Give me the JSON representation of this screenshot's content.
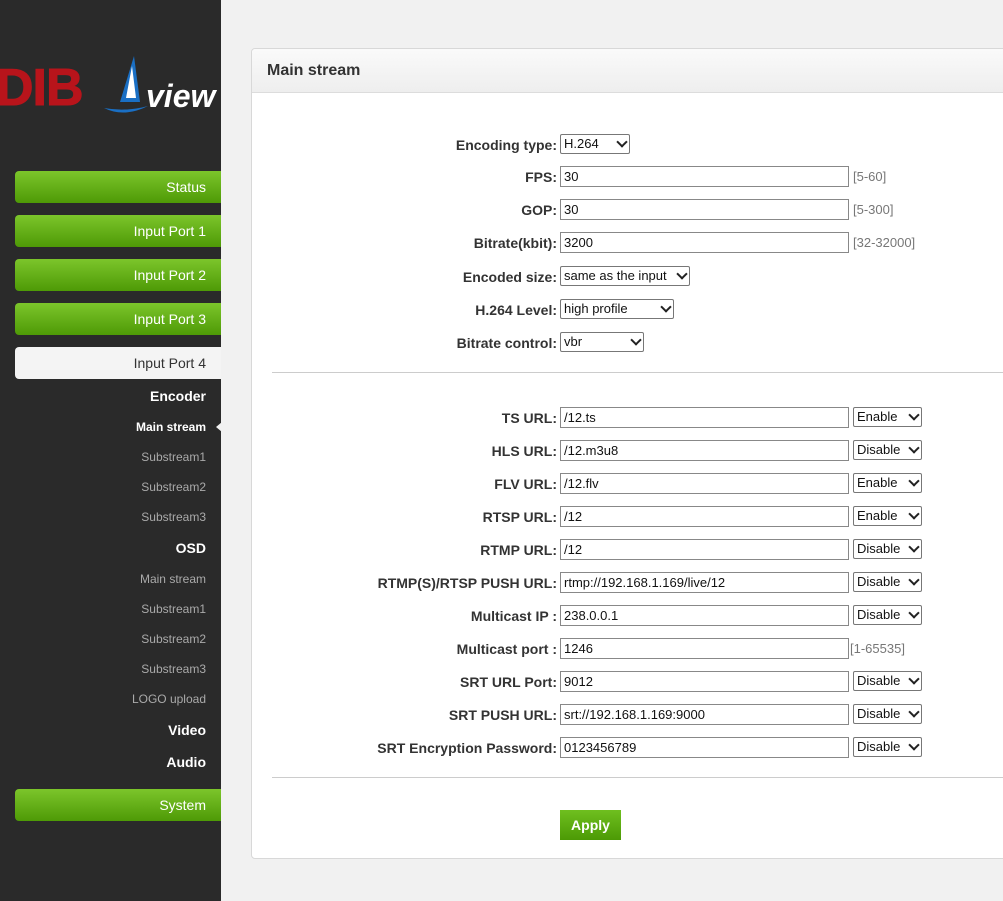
{
  "logo": {
    "left_text": "DIB",
    "right_text": "view"
  },
  "sidebar": {
    "buttons": {
      "status": "Status",
      "input1": "Input Port 1",
      "input2": "Input Port 2",
      "input3": "Input Port 3",
      "input4": "Input Port 4",
      "system": "System"
    },
    "encoder": {
      "heading": "Encoder",
      "items": [
        "Main stream",
        "Substream1",
        "Substream2",
        "Substream3"
      ]
    },
    "osd": {
      "heading": "OSD",
      "items": [
        "Main stream",
        "Substream1",
        "Substream2",
        "Substream3",
        "LOGO upload"
      ]
    },
    "video": "Video",
    "audio": "Audio"
  },
  "panel": {
    "title": "Main stream",
    "encoding": {
      "encoding_type": {
        "label": "Encoding type:",
        "value": "H.264"
      },
      "fps": {
        "label": "FPS:",
        "value": "30",
        "range": "[5-60]"
      },
      "gop": {
        "label": "GOP:",
        "value": "30",
        "range": "[5-300]"
      },
      "bitrate": {
        "label": "Bitrate(kbit):",
        "value": "3200",
        "range": "[32-32000]"
      },
      "encoded_size": {
        "label": "Encoded size:",
        "value": "same as the input"
      },
      "h264_level": {
        "label": "H.264 Level:",
        "value": "high profile"
      },
      "bitrate_control": {
        "label": "Bitrate control:",
        "value": "vbr"
      }
    },
    "urls": {
      "ts": {
        "label": "TS URL:",
        "value": "/12.ts",
        "state": "Enable"
      },
      "hls": {
        "label": "HLS URL:",
        "value": "/12.m3u8",
        "state": "Disable"
      },
      "flv": {
        "label": "FLV URL:",
        "value": "/12.flv",
        "state": "Enable"
      },
      "rtsp": {
        "label": "RTSP URL:",
        "value": "/12",
        "state": "Enable"
      },
      "rtmp": {
        "label": "RTMP URL:",
        "value": "/12",
        "state": "Disable"
      },
      "push": {
        "label": "RTMP(S)/RTSP PUSH URL:",
        "value": "rtmp://192.168.1.169/live/12",
        "state": "Disable"
      },
      "multicast_ip": {
        "label": "Multicast IP :",
        "value": "238.0.0.1",
        "state": "Disable"
      },
      "multicast_port": {
        "label": "Multicast port :",
        "value": "1246",
        "range": "[1-65535]"
      },
      "srt_port": {
        "label": "SRT URL Port:",
        "value": "9012",
        "state": "Disable"
      },
      "srt_push": {
        "label": "SRT PUSH URL:",
        "value": "srt://192.168.1.169:9000",
        "state": "Disable"
      },
      "srt_password": {
        "label": "SRT Encryption Password:",
        "value": "0123456789",
        "state": "Disable"
      }
    },
    "apply_label": "Apply"
  }
}
